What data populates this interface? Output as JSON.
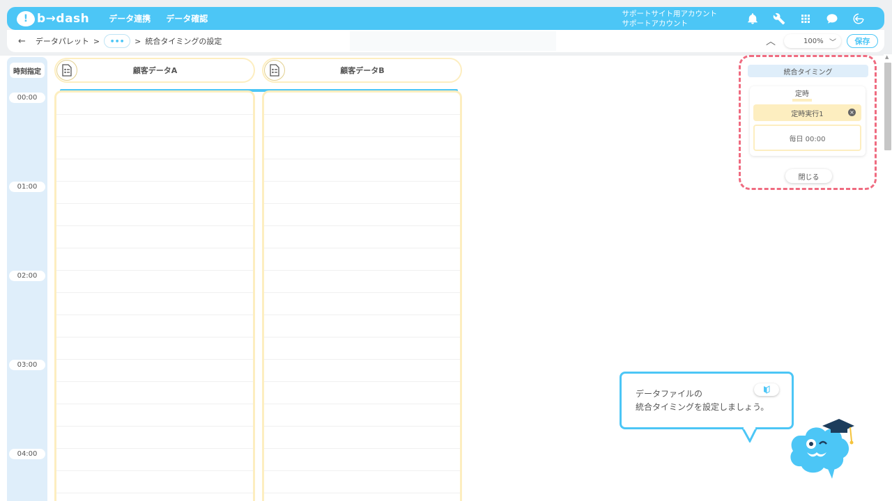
{
  "header": {
    "logo_mark": "!",
    "logo_text": "b→dash",
    "nav": [
      "データ連携",
      "データ確認"
    ],
    "account_line1": "サポートサイト用アカウント",
    "account_line2": "サポートアカウント",
    "icons": [
      "bell-icon",
      "wrench-icon",
      "grid-icon",
      "chat-icon",
      "logout-icon"
    ],
    "color": "#4cc6f6"
  },
  "subbar": {
    "back": "←",
    "crumb_root": "データパレット",
    "crumb_sep": ">",
    "crumb_more": "•••",
    "crumb_current": "統合タイミングの設定",
    "zoom": "100%",
    "save": "保存"
  },
  "timeline": {
    "head": "時刻指定",
    "times": [
      "00:00",
      "01:00",
      "02:00",
      "03:00",
      "04:00"
    ]
  },
  "columns": [
    {
      "title": "顧客データA"
    },
    {
      "title": "顧客データB"
    }
  ],
  "panel": {
    "title": "統合タイミング",
    "tag": "定時",
    "item": "定時実行1",
    "schedule": "毎日 00:00",
    "close": "閉じる",
    "border_color": "#ef6b80",
    "accent": "#fdeec0"
  },
  "tooltip": {
    "line1": "データファイルの",
    "line2": "統合タイミングを設定しましょう。"
  }
}
